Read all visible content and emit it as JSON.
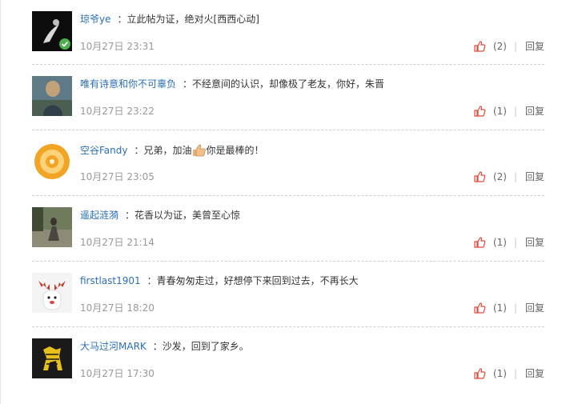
{
  "colors": {
    "username": "#2b6fb6",
    "like_icon": "#e04a3d",
    "time": "#999999"
  },
  "comments": [
    {
      "user": "琼爷ye",
      "colon": "：",
      "text": "立此帖为证，绝对火[西西心动]",
      "text_after": "",
      "time": "10月27日 23:31",
      "likes": "(2)",
      "separator": "|",
      "reply": "回复",
      "avatar": "dark-silhouette-avatar",
      "verified": true
    },
    {
      "user": "唯有诗意和你不可辜负",
      "colon": "：",
      "text": "不经意间的认识，却像极了老友，你好，朱晋",
      "text_after": "",
      "time": "10月27日 23:22",
      "likes": "(1)",
      "separator": "|",
      "reply": "回复",
      "avatar": "landscape-avatar"
    },
    {
      "user": "空谷Fandy",
      "colon": "：",
      "text": "兄弟，加油",
      "text_after": "你是最棒的！",
      "emoji": "thumbs-up-emoji",
      "time": "10月27日 23:05",
      "likes": "(2)",
      "separator": "|",
      "reply": "回复",
      "avatar": "orange-swirl-avatar"
    },
    {
      "user": "遥起涟漪",
      "colon": "：",
      "text": "花香以为证，美曾至心惊",
      "text_after": "",
      "time": "10月27日 21:14",
      "likes": "(1)",
      "separator": "|",
      "reply": "回复",
      "avatar": "street-avatar"
    },
    {
      "user": "firstlast1901",
      "colon": "：",
      "text": "青春匆匆走过，好想停下来回到过去，不再长大",
      "text_after": "",
      "time": "10月27日 18:20",
      "likes": "(1)",
      "separator": "|",
      "reply": "回复",
      "avatar": "moose-avatar"
    },
    {
      "user": "大马过河MARK",
      "colon": "：",
      "text": "沙发，回到了家乡。",
      "text_after": "",
      "time": "10月27日 17:30",
      "likes": "(1)",
      "separator": "|",
      "reply": "回复",
      "avatar": "zebra-horse-avatar"
    }
  ]
}
